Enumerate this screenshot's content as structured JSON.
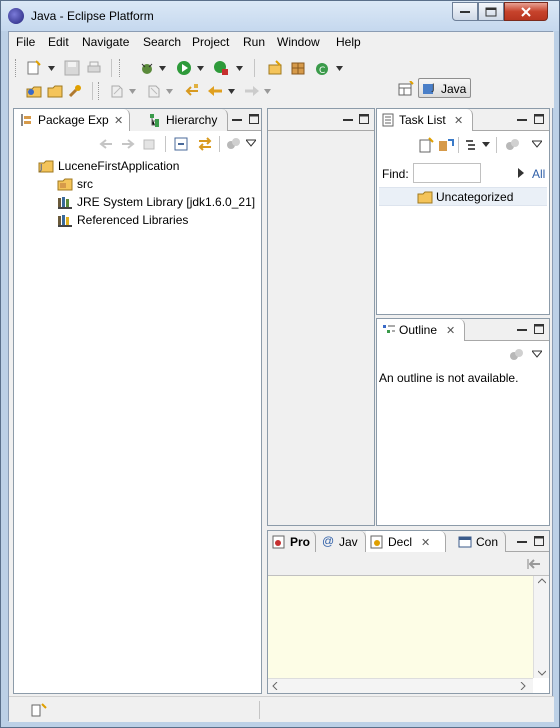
{
  "window": {
    "title": "Java - Eclipse Platform"
  },
  "menubar": {
    "items": [
      {
        "label": "File"
      },
      {
        "label": "Edit"
      },
      {
        "label": "Navigate"
      },
      {
        "label": "Search"
      },
      {
        "label": "Project"
      },
      {
        "label": "Run"
      },
      {
        "label": "Window"
      },
      {
        "label": "Help"
      }
    ]
  },
  "toolbar": {
    "perspective_label": "Java"
  },
  "package_explorer": {
    "tabs": [
      {
        "label": "Package Exp",
        "active": true
      },
      {
        "label": "Hierarchy",
        "active": false
      }
    ],
    "tree": [
      {
        "label": "LuceneFirstApplication",
        "icon": "java-project-icon",
        "level": 0
      },
      {
        "label": "src",
        "icon": "source-folder-icon",
        "level": 1
      },
      {
        "label": "JRE System Library [jdk1.6.0_21]",
        "icon": "library-icon",
        "level": 1
      },
      {
        "label": "Referenced Libraries",
        "icon": "library-icon",
        "level": 1
      }
    ]
  },
  "task_list": {
    "tab_label": "Task List",
    "find_label": "Find:",
    "find_value": "",
    "all_label": "All",
    "category": "Uncategorized"
  },
  "outline": {
    "tab_label": "Outline",
    "message": "An outline is not available."
  },
  "bottom_panel": {
    "tabs": [
      {
        "label": "Pro",
        "icon": "problems-icon"
      },
      {
        "label": "Jav",
        "icon": "at-icon"
      },
      {
        "label": "Decl",
        "icon": "declaration-icon",
        "active": true
      },
      {
        "label": "Con",
        "icon": "console-icon"
      }
    ],
    "background": "#fdfde6"
  },
  "colors": {
    "accent": "#2f5fa8",
    "title_gradient_top": "#dbe8f6",
    "close_button": "#c7432c"
  }
}
